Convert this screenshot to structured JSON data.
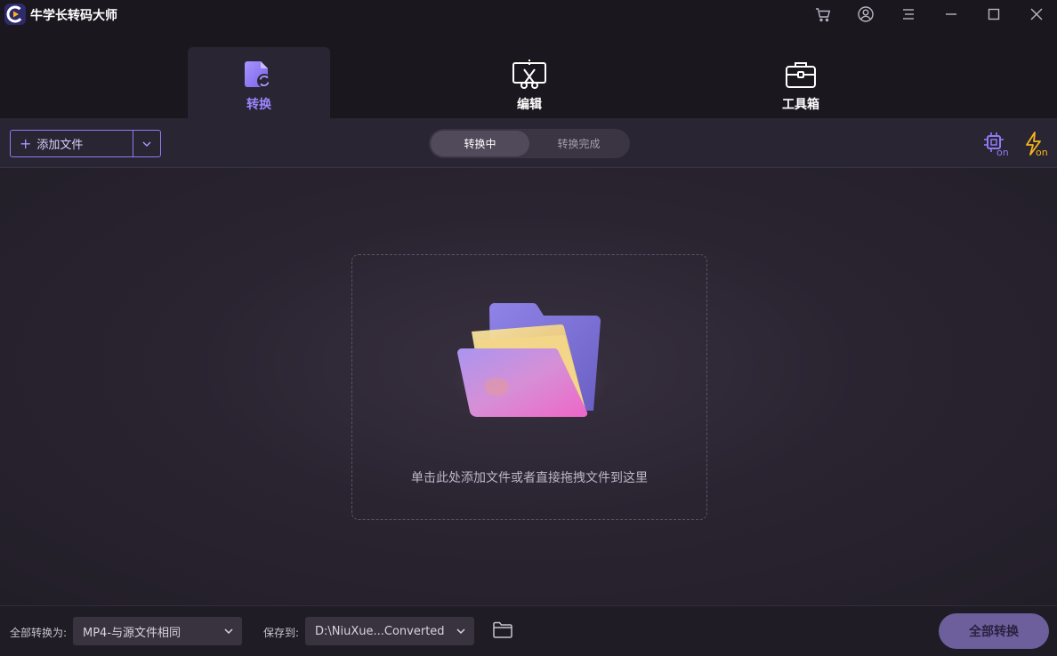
{
  "app": {
    "title": "牛学长转码大师"
  },
  "window_controls": [
    "cart-icon",
    "account-icon",
    "menu-icon",
    "minimize-icon",
    "maximize-icon",
    "close-icon"
  ],
  "main_tabs": [
    {
      "label": "转换",
      "icon": "convert-icon",
      "active": true
    },
    {
      "label": "编辑",
      "icon": "edit-cut-icon",
      "active": false
    },
    {
      "label": "工具箱",
      "icon": "toolbox-icon",
      "active": false
    }
  ],
  "toolbar": {
    "add_file_label": "添加文件",
    "segments": [
      {
        "label": "转换中",
        "active": true
      },
      {
        "label": "转换完成",
        "active": false
      }
    ],
    "hw_accel_badge": "on",
    "fast_convert_badge": "on"
  },
  "dropzone": {
    "hint": "单击此处添加文件或者直接拖拽文件到这里"
  },
  "bottom": {
    "convert_all_to_label": "全部转换为:",
    "format_value": "MP4-与源文件相同",
    "save_to_label": "保存到:",
    "save_path": "D:\\NiuXue...Converted",
    "convert_all_button": "全部转换"
  },
  "colors": {
    "accent": "#8f7cf3",
    "bolt": "#f5b51d",
    "background": "#1c1821"
  }
}
